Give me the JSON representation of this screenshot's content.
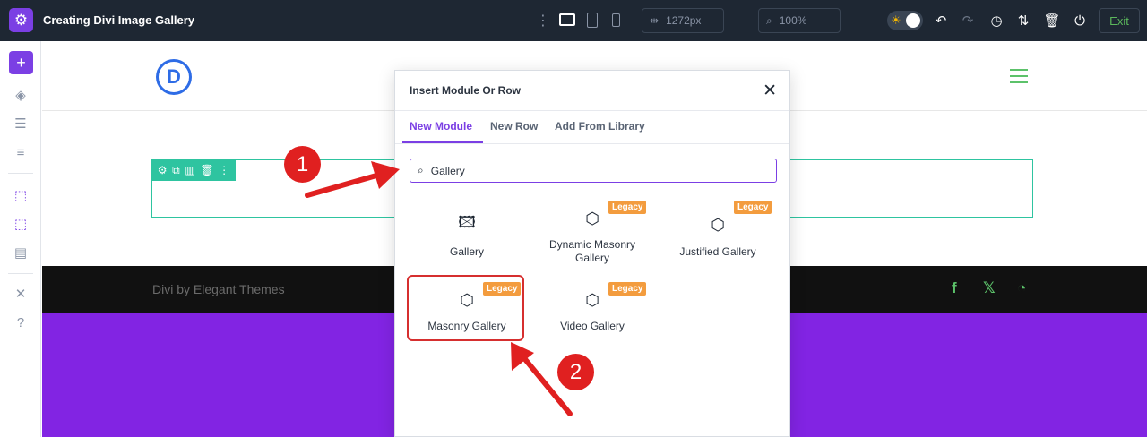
{
  "app": {
    "title": "Creating Divi Image Gallery",
    "width_value": "1272px",
    "zoom_value": "100%",
    "exit_label": "Exit"
  },
  "site": {
    "logo_letter": "D",
    "footer_text": "Divi by Elegant Themes"
  },
  "modal": {
    "title": "Insert Module Or Row",
    "tabs": [
      "New Module",
      "New Row",
      "Add From Library"
    ],
    "search_value": "Gallery",
    "modules": [
      {
        "label": "Gallery",
        "legacy": false
      },
      {
        "label": "Dynamic Masonry Gallery",
        "legacy": true
      },
      {
        "label": "Justified Gallery",
        "legacy": true
      },
      {
        "label": "Masonry Gallery",
        "legacy": true
      },
      {
        "label": "Video Gallery",
        "legacy": true
      }
    ],
    "badge_label": "Legacy"
  },
  "annotations": {
    "step1": "1",
    "step2": "2"
  },
  "colors": {
    "accent": "#7b3fe4",
    "topbar": "#1e2733",
    "row_outline": "#2ec4a0",
    "purple_band": "#8224e3",
    "annotation_red": "#e02020"
  }
}
